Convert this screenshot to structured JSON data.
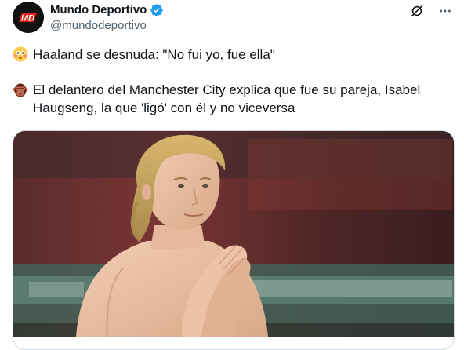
{
  "author": {
    "display_name": "Mundo Deportivo",
    "handle": "@mundodeportivo",
    "avatar_text": "MD",
    "verified": true
  },
  "icons": {
    "grok": "grok-icon",
    "more": "more-options-icon",
    "verified": "verified-badge-icon"
  },
  "tweet": {
    "line1_emoji": "flushed-face-emoji",
    "line1": "Haaland se desnuda: \"No fui yo, fue ella\"",
    "line2_emoji": "see-no-evil-monkey-emoji",
    "line2": "El delantero del Manchester City explica que fue su pareja, Isabel Haugseng, la que 'ligó' con él y no viceversa"
  },
  "colors": {
    "verified_blue": "#1d9bf0",
    "secondary_text": "#536471",
    "avatar_accent": "#e5231b"
  }
}
